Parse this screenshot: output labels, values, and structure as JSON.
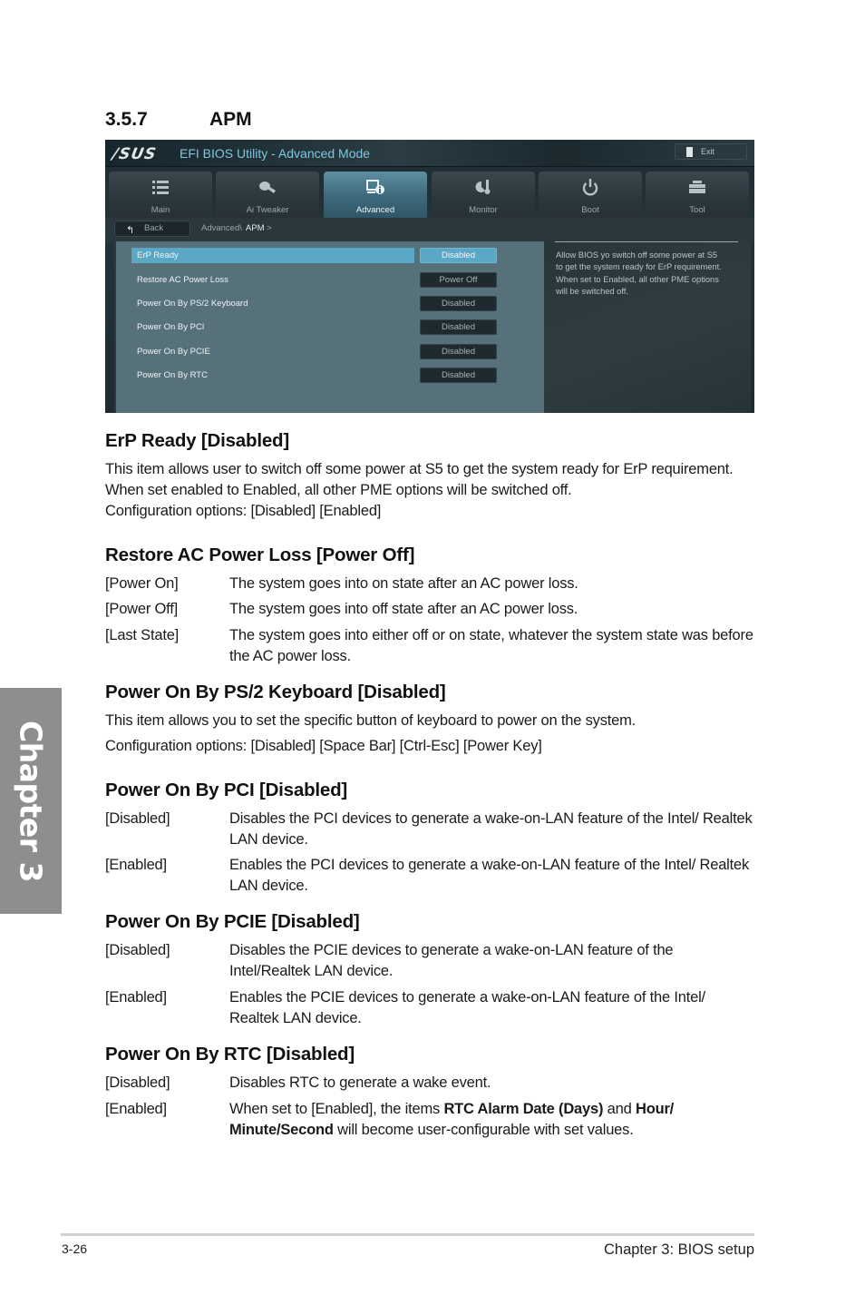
{
  "section": {
    "number": "3.5.7",
    "title": "APM"
  },
  "bios": {
    "brand": "/SUS",
    "title": "EFI BIOS Utility - Advanced Mode",
    "exit_label": "Exit",
    "tabs": [
      {
        "label": "Main",
        "icon": "list-icon",
        "active": false
      },
      {
        "label": "Ai  Tweaker",
        "icon": "tweaker-icon",
        "active": false
      },
      {
        "label": "Advanced",
        "icon": "advanced-info-icon",
        "active": true
      },
      {
        "label": "Monitor",
        "icon": "thermometer-icon",
        "active": false
      },
      {
        "label": "Boot",
        "icon": "power-icon",
        "active": false
      },
      {
        "label": "Tool",
        "icon": "toolbox-icon",
        "active": false
      }
    ],
    "back_label": "Back",
    "breadcrumb": {
      "path": "Advanced\\",
      "current": "APM",
      "arrow": ">"
    },
    "settings": [
      {
        "label": "ErP Ready",
        "value": "Disabled",
        "selected": true
      },
      {
        "label": "Restore AC Power Loss",
        "value": "Power Off",
        "selected": false
      },
      {
        "label": "Power On By PS/2 Keyboard",
        "value": "Disabled",
        "selected": false
      },
      {
        "label": "Power On By PCI",
        "value": "Disabled",
        "selected": false
      },
      {
        "label": "Power On By PCIE",
        "value": "Disabled",
        "selected": false
      },
      {
        "label": "Power On By RTC",
        "value": "Disabled",
        "selected": false
      }
    ],
    "help_text": "Allow BIOS yo switch off some power at S5 to get the system ready for ErP requirement. When set to Enabled, all other PME options will be switched off.",
    "colors": {
      "accent": "#5aa8c6",
      "panel": "#57717b",
      "title": "#7fc6e0"
    }
  },
  "content": {
    "erp": {
      "heading": "ErP Ready [Disabled]",
      "body": "This item allows user to switch off some power at S5 to get the system ready for ErP requirement. When set enabled to Enabled, all other PME options will be switched off.",
      "config": "Configuration options: [Disabled] [Enabled]"
    },
    "restore_ac": {
      "heading": "Restore AC Power Loss [Power Off]",
      "options": [
        {
          "key": "[Power On]",
          "desc": "The system goes into on state after an AC power loss."
        },
        {
          "key": "[Power Off]",
          "desc": "The system goes into off state after an AC power loss."
        },
        {
          "key": "[Last State]",
          "desc": "The system goes into either off or on state, whatever the system state was before the AC power loss."
        }
      ]
    },
    "ps2": {
      "heading": "Power On By PS/2 Keyboard [Disabled]",
      "body": "This item allows you to set the specific button of keyboard to power on the system.",
      "config": "Configuration options: [Disabled] [Space Bar] [Ctrl-Esc] [Power Key]"
    },
    "pci": {
      "heading": "Power On By PCI [Disabled]",
      "options": [
        {
          "key": "[Disabled]",
          "desc": "Disables the PCI devices to generate a wake-on-LAN feature of the Intel/ Realtek LAN device."
        },
        {
          "key": "[Enabled]",
          "desc": "Enables the PCI devices to generate a wake-on-LAN feature of the Intel/ Realtek LAN device."
        }
      ]
    },
    "pcie": {
      "heading": "Power On By PCIE [Disabled]",
      "options": [
        {
          "key": "[Disabled]",
          "desc": "Disables the PCIE devices to generate a wake-on-LAN feature of the Intel/Realtek LAN device."
        },
        {
          "key": "[Enabled]",
          "desc": "Enables the PCIE devices to generate a wake-on-LAN feature of the Intel/ Realtek LAN device."
        }
      ]
    },
    "rtc": {
      "heading": "Power On By RTC [Disabled]",
      "options": [
        {
          "key": "[Disabled]",
          "desc": "Disables RTC to generate a wake event."
        },
        {
          "key": "[Enabled]",
          "desc_parts": {
            "p1": "When set to [Enabled], the items ",
            "b1": "RTC Alarm Date (Days)",
            "p2": " and ",
            "b2": "Hour/ Minute/Second",
            "p3": " will become user-configurable with set values."
          }
        }
      ]
    }
  },
  "chapter_tab": "Chapter 3",
  "footer": {
    "page": "3-26",
    "chapter": "Chapter 3: BIOS setup"
  }
}
